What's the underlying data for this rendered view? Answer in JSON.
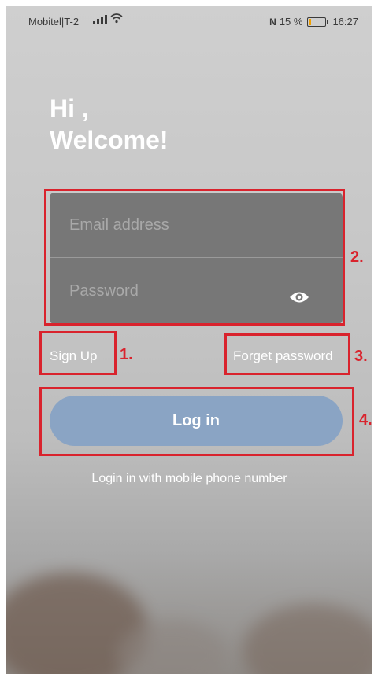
{
  "status_bar": {
    "carrier": "Mobitel|T-2",
    "signal_icon": "signal-bars-icon",
    "wifi_icon": "wifi-icon",
    "nfc_icon": "nfc-icon",
    "nfc_glyph": "N",
    "battery_percent_text": "15 %",
    "battery_level": 0.15,
    "time": "16:27",
    "battery_color": "#f0a000"
  },
  "greeting": {
    "line1": "Hi ,",
    "line2": "Welcome!"
  },
  "form": {
    "email_placeholder": "Email address",
    "password_placeholder": "Password",
    "toggle_icon": "eye-icon"
  },
  "links": {
    "sign_up": "Sign Up",
    "forget_password": "Forget password"
  },
  "actions": {
    "login_label": "Log in",
    "login_phone_label": "Login in with mobile phone number",
    "login_color": "#8aa4c4"
  },
  "annotations": {
    "n1": "1.",
    "n2": "2.",
    "n3": "3.",
    "n4": "4.",
    "color": "#d9232d"
  }
}
